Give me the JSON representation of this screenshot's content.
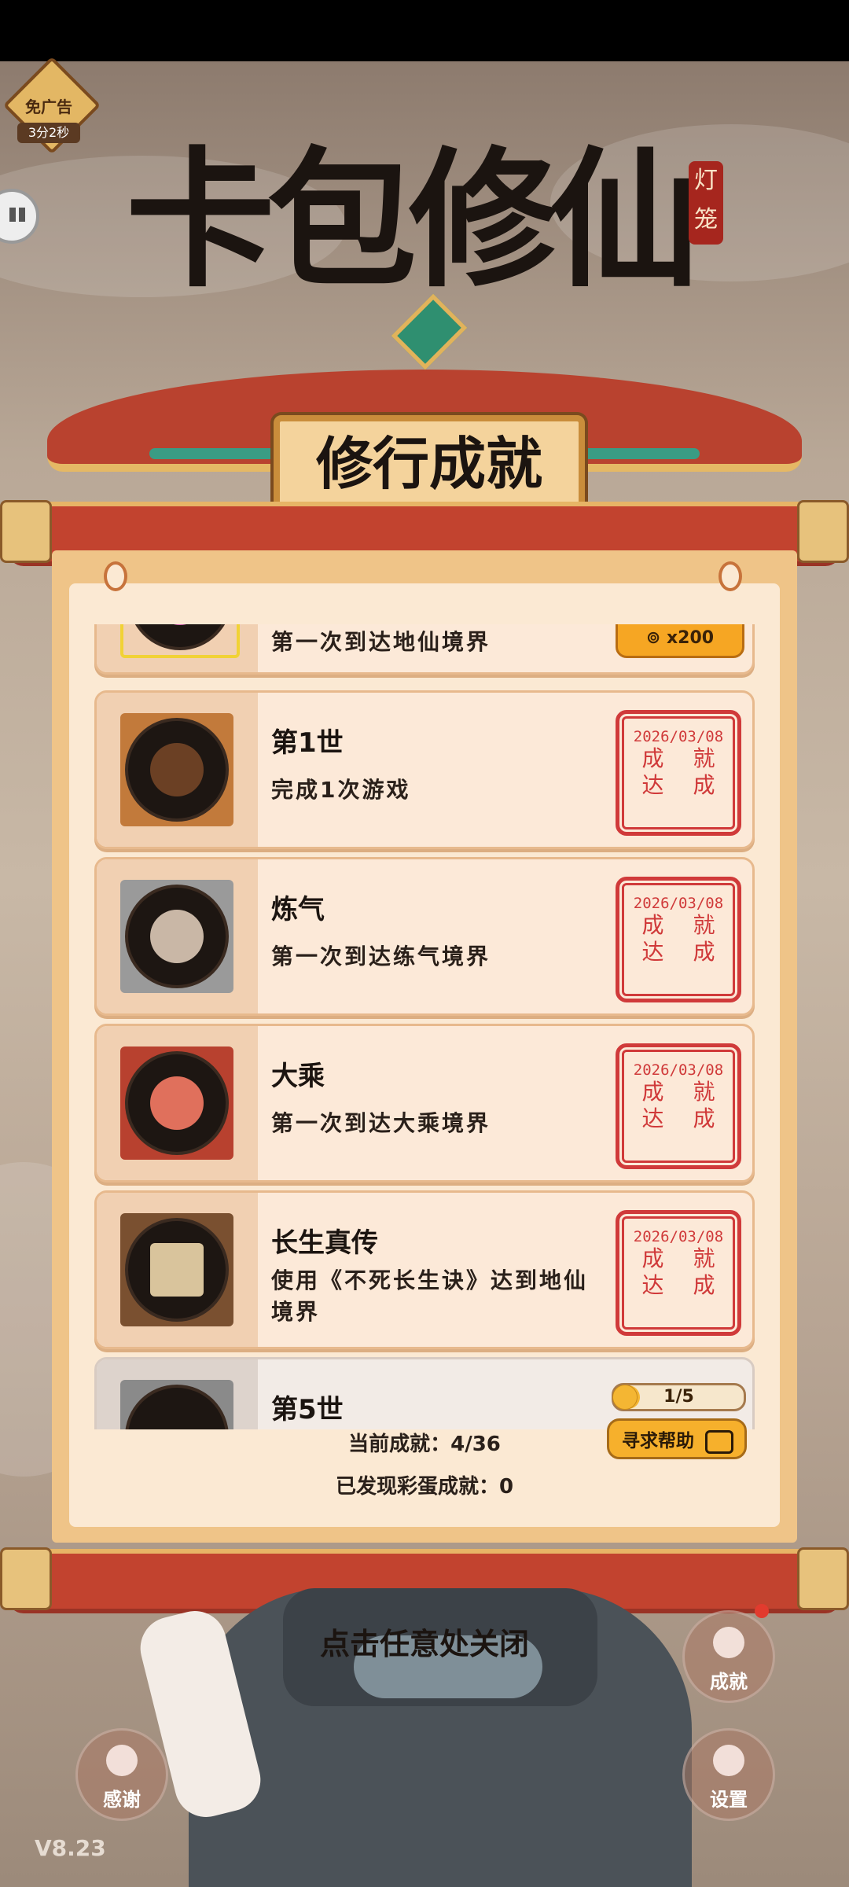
{
  "ad_badge": {
    "label": "免广告",
    "timer": "3分2秒"
  },
  "title": {
    "main": "卡包修仙",
    "tag": "灯笼"
  },
  "panel_title": "修行成就",
  "achievements": [
    {
      "name": "",
      "desc": "第一次到达地仙境界",
      "reward": "x200",
      "icon": "aura-icon"
    },
    {
      "name": "第1世",
      "desc": "完成1次游戏",
      "stamp_date": "2026/03/08",
      "stamp_text": "成就达成",
      "icon": "eye-icon"
    },
    {
      "name": "炼气",
      "desc": "第一次到达练气境界",
      "stamp_date": "2026/03/08",
      "stamp_text": "成就达成",
      "icon": "qi-icon"
    },
    {
      "name": "大乘",
      "desc": "第一次到达大乘境界",
      "stamp_date": "2026/03/08",
      "stamp_text": "成就达成",
      "icon": "meditation-icon"
    },
    {
      "name": "长生真传",
      "desc": "使用《不死长生诀》达到地仙境界",
      "stamp_date": "2026/03/08",
      "stamp_text": "成就达成",
      "icon": "book-icon"
    },
    {
      "name": "第5世",
      "progress_text": "1/5",
      "progress": 0.2,
      "icon": "eye-icon"
    }
  ],
  "stamp_words": {
    "l1": "成 就",
    "l2": "达 成"
  },
  "summary": {
    "current": "当前成就：4/36",
    "easter": "已发现彩蛋成就：0"
  },
  "help_button": "寻求帮助",
  "close_hint": "点击任意处关闭",
  "bottom_buttons": {
    "achievement": "成就",
    "thanks": "感谢",
    "settings": "设置"
  },
  "version": "V8.23",
  "colors": {
    "panel": "#efc488",
    "stamp": "#d03a3a",
    "button": "#f6b02c",
    "progress_fill": "#f4b633"
  }
}
